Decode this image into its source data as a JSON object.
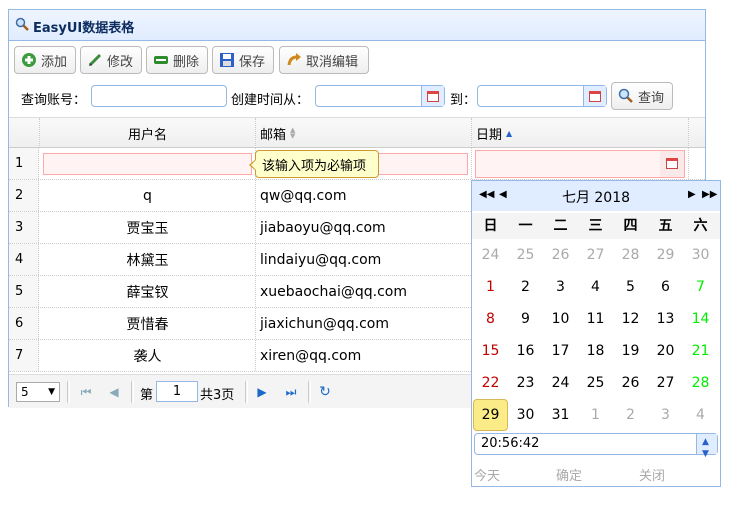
{
  "panel": {
    "title": "EasyUI数据表格"
  },
  "toolbar": {
    "add": "添加",
    "edit": "修改",
    "remove": "删除",
    "save": "保存",
    "cancel": "取消编辑"
  },
  "search": {
    "account_label": "查询账号：",
    "created_from_label": "创建时间从：",
    "to_label": "到：",
    "query_button": "查询"
  },
  "grid": {
    "columns": {
      "username": "用户名",
      "email": "邮箱",
      "date": "日期"
    },
    "rows": [
      {
        "n": "1",
        "username": "",
        "email": "",
        "date": ""
      },
      {
        "n": "2",
        "username": "q",
        "email": "qw@qq.com"
      },
      {
        "n": "3",
        "username": "贾宝玉",
        "email": "jiabaoyu@qq.com"
      },
      {
        "n": "4",
        "username": "林黛玉",
        "email": "lindaiyu@qq.com"
      },
      {
        "n": "5",
        "username": "薛宝钗",
        "email": "xuebaochai@qq.com"
      },
      {
        "n": "6",
        "username": "贾惜春",
        "email": "jiaxichun@qq.com"
      },
      {
        "n": "7",
        "username": "袭人",
        "email": "xiren@qq.com"
      }
    ],
    "validation_tip": "该输入项为必输项"
  },
  "pager": {
    "page_size": "5",
    "page_label": "第",
    "page_value": "1",
    "total_label": "共3页"
  },
  "calendar": {
    "title": "七月 2018",
    "weekdays": [
      "日",
      "一",
      "二",
      "三",
      "四",
      "五",
      "六"
    ],
    "weeks": [
      [
        "24",
        "25",
        "26",
        "27",
        "28",
        "29",
        "30"
      ],
      [
        "1",
        "2",
        "3",
        "4",
        "5",
        "6",
        "7"
      ],
      [
        "8",
        "9",
        "10",
        "11",
        "12",
        "13",
        "14"
      ],
      [
        "15",
        "16",
        "17",
        "18",
        "19",
        "20",
        "21"
      ],
      [
        "22",
        "23",
        "24",
        "25",
        "26",
        "27",
        "28"
      ],
      [
        "29",
        "30",
        "31",
        "1",
        "2",
        "3",
        "4"
      ]
    ],
    "selected": "29",
    "time": "20:56:42",
    "today": "今天",
    "ok": "确定",
    "close": "关闭",
    "colors": {
      "sunday": "#c00000",
      "saturday": "#00ee00",
      "other_month": "#aaaaaa",
      "selected_bg": "#fbec88"
    }
  }
}
